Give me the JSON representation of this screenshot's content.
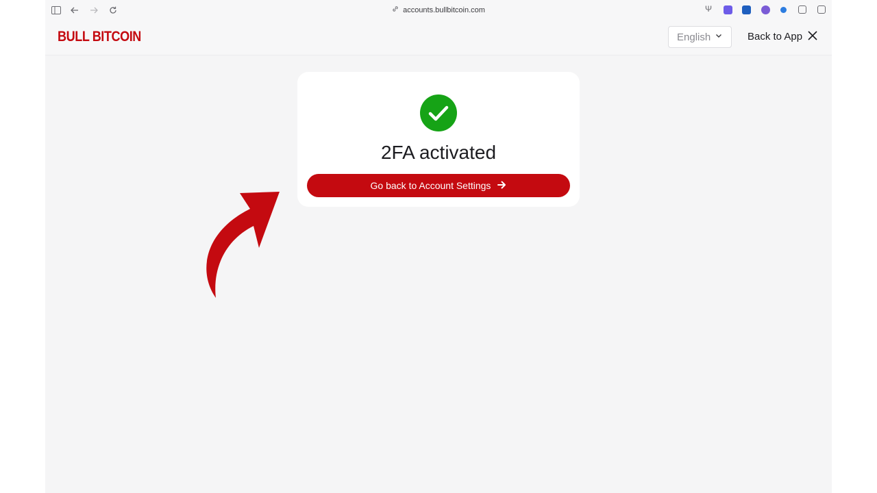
{
  "browser": {
    "url": "accounts.bullbitcoin.com",
    "icons": [
      "sidebar-icon",
      "back-arrow-icon",
      "forward-arrow-icon",
      "reload-icon",
      "link-icon"
    ]
  },
  "header": {
    "logo_text": "BULL BITCOIN",
    "language": "English",
    "back_to_app": "Back to App"
  },
  "card": {
    "title": "2FA activated",
    "button_label": "Go back to Account Settings"
  },
  "colors": {
    "brand_red": "#c40a10",
    "success_green": "#16a316",
    "page_bg": "#f5f5f6"
  }
}
